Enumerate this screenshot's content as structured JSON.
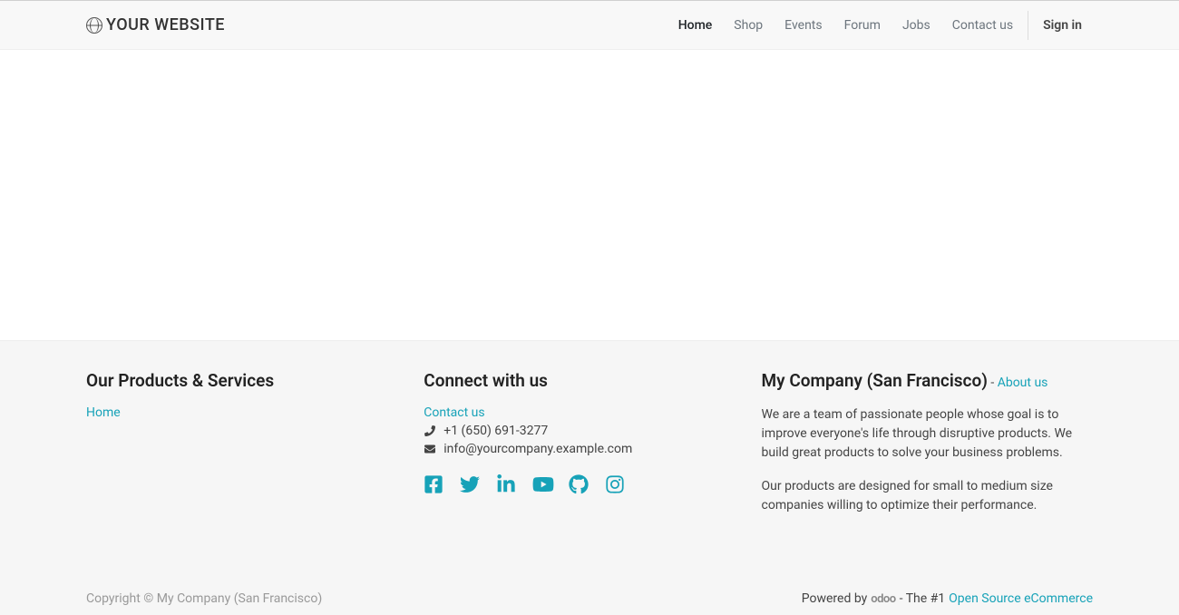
{
  "brand": "YOUR WEBSITE",
  "nav": {
    "home": "Home",
    "shop": "Shop",
    "events": "Events",
    "forum": "Forum",
    "jobs": "Jobs",
    "contact": "Contact us",
    "signin": "Sign in"
  },
  "footer": {
    "col1": {
      "heading": "Our Products & Services",
      "home_link": "Home"
    },
    "col2": {
      "heading": "Connect with us",
      "contact_link": "Contact us",
      "phone": "+1 (650) 691-3277",
      "email": "info@yourcompany.example.com"
    },
    "col3": {
      "heading": "My Company (San Francisco)",
      "dash": " - ",
      "about_link": "About us",
      "para1": "We are a team of passionate people whose goal is to improve everyone's life through disruptive products. We build great products to solve your business problems.",
      "para2": "Our products are designed for small to medium size companies willing to optimize their performance."
    }
  },
  "bottom": {
    "copyright": "Copyright © My Company (San Francisco)",
    "powered_by": "Powered by",
    "odoo": "odoo",
    "dash2": " - The #1 ",
    "ecommerce_link": "Open Source eCommerce"
  }
}
